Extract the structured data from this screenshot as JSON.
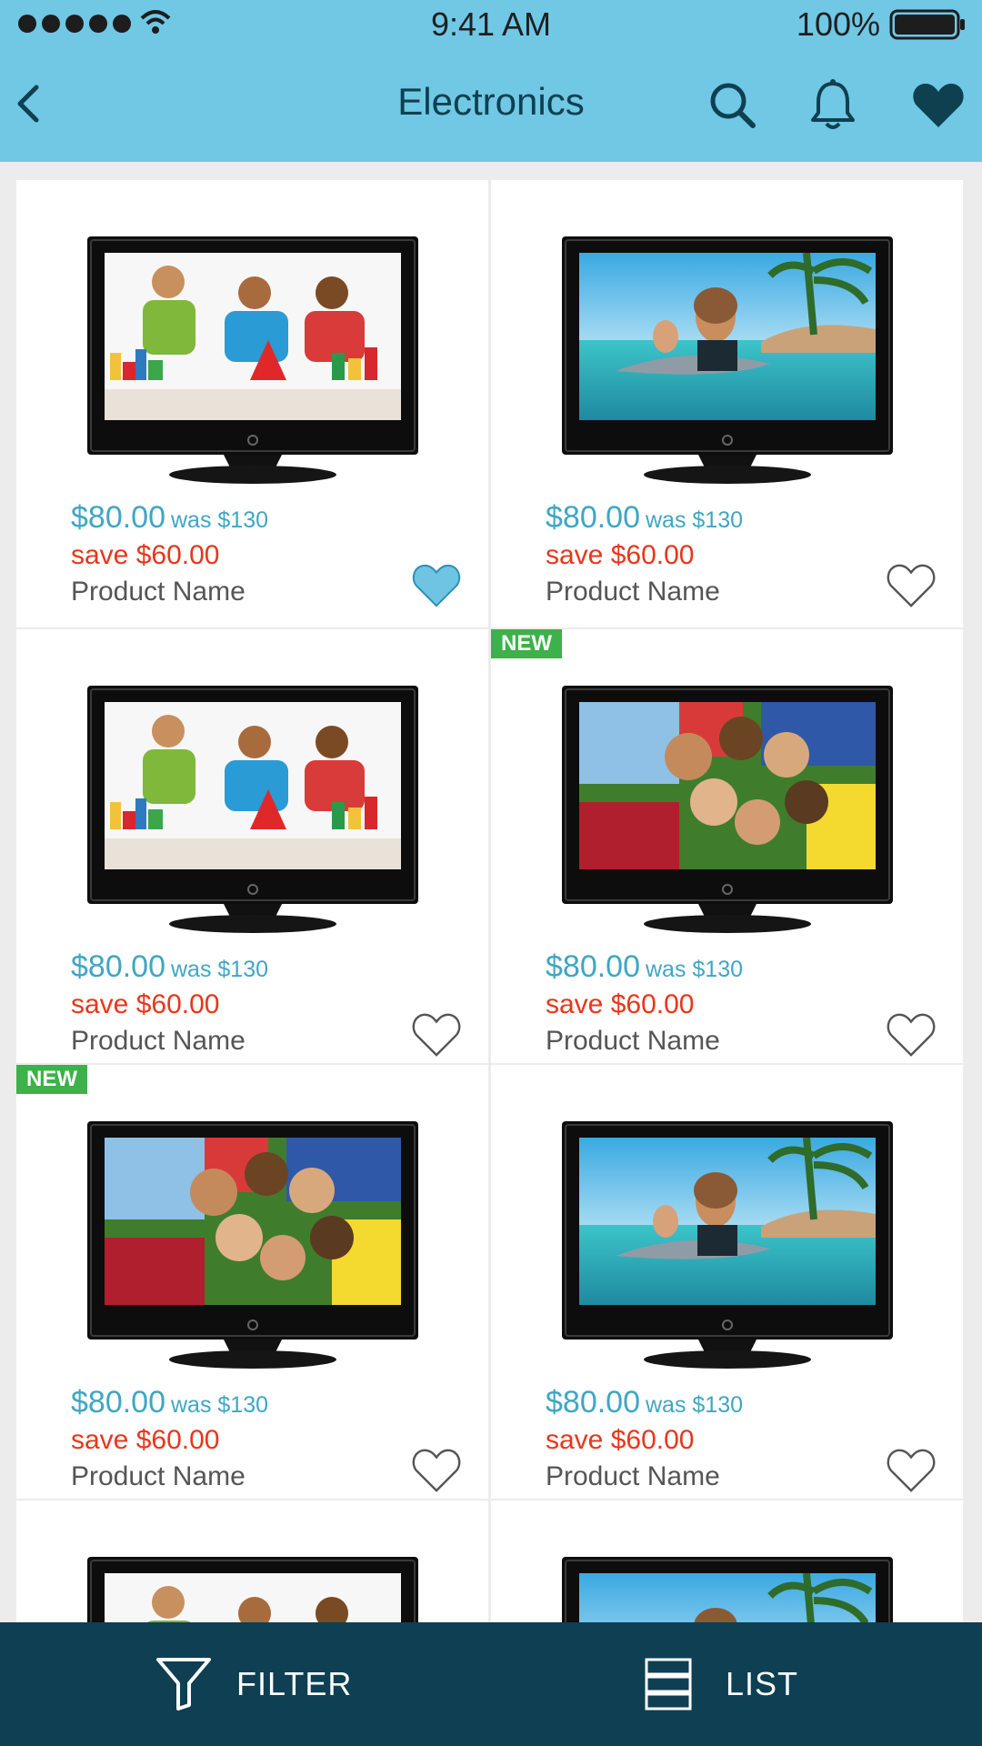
{
  "status_bar": {
    "time": "9:41 AM",
    "battery": "100%"
  },
  "header": {
    "title": "Electronics"
  },
  "products": [
    {
      "price": "$80.00",
      "was": "was $130",
      "save": "save $60.00",
      "name": "Product Name",
      "favorite": true,
      "is_new": false,
      "badge": "",
      "scene": "kids-blocks"
    },
    {
      "price": "$80.00",
      "was": "was $130",
      "save": "save $60.00",
      "name": "Product Name",
      "favorite": false,
      "is_new": false,
      "badge": "",
      "scene": "dolphin"
    },
    {
      "price": "$80.00",
      "was": "was $130",
      "save": "save $60.00",
      "name": "Product Name",
      "favorite": false,
      "is_new": false,
      "badge": "",
      "scene": "kids-blocks"
    },
    {
      "price": "$80.00",
      "was": "was $130",
      "save": "save $60.00",
      "name": "Product Name",
      "favorite": false,
      "is_new": true,
      "badge": "NEW",
      "scene": "kids-grass"
    },
    {
      "price": "$80.00",
      "was": "was $130",
      "save": "save $60.00",
      "name": "Product Name",
      "favorite": false,
      "is_new": true,
      "badge": "NEW",
      "scene": "kids-grass"
    },
    {
      "price": "$80.00",
      "was": "was $130",
      "save": "save $60.00",
      "name": "Product Name",
      "favorite": false,
      "is_new": false,
      "badge": "",
      "scene": "dolphin"
    },
    {
      "price": "",
      "was": "",
      "save": "",
      "name": "",
      "favorite": false,
      "is_new": false,
      "badge": "",
      "scene": "kids-blocks"
    },
    {
      "price": "",
      "was": "",
      "save": "",
      "name": "",
      "favorite": false,
      "is_new": false,
      "badge": "",
      "scene": "dolphin"
    }
  ],
  "bottom_bar": {
    "filter_label": "FILTER",
    "list_label": "LIST"
  },
  "colors": {
    "header_bg": "#70c8e5",
    "bottom_bar_bg": "#0e3f52",
    "price": "#3fa6c4",
    "save": "#e8361c",
    "new_badge": "#3db14a",
    "favorite_active": "#6fc3e3"
  }
}
